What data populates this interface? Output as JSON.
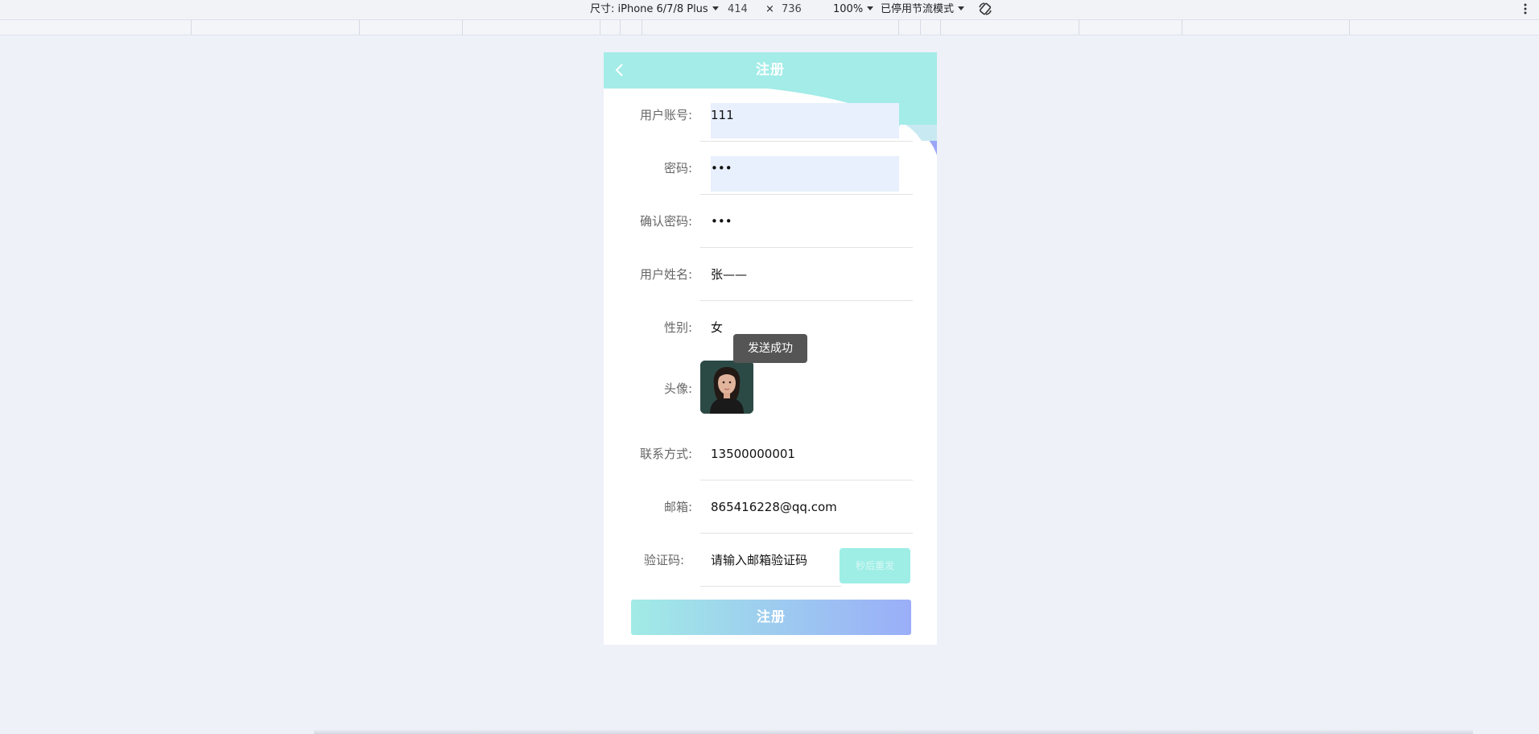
{
  "devtools": {
    "size_label": "尺寸: iPhone 6/7/8 Plus",
    "width": "414",
    "times": "×",
    "height": "736",
    "zoom": "100%",
    "throttle": "已停用节流模式"
  },
  "header": {
    "title": "注册",
    "back_icon": "chevron-left-icon"
  },
  "form": {
    "account": {
      "label": "用户账号:",
      "value": "111"
    },
    "password": {
      "label": "密码:",
      "value": "•••"
    },
    "confirm": {
      "label": "确认密码:",
      "value": "•••"
    },
    "name": {
      "label": "用户姓名:",
      "value": "张——"
    },
    "gender": {
      "label": "性别:",
      "value": "女"
    },
    "avatar": {
      "label": "头像:"
    },
    "phone": {
      "label": "联系方式:",
      "value": "13500000001"
    },
    "email": {
      "label": "邮箱:",
      "value": "865416228@qq.com"
    },
    "code": {
      "label": "验证码:",
      "placeholder": "请输入邮箱验证码",
      "button": "秒后重发"
    }
  },
  "toast": "发送成功",
  "submit": "注册",
  "colors": {
    "header": "#a3ece8",
    "accent_purple": "#9ba6f7",
    "submit_start": "#a1ebe6",
    "submit_end": "#9aaef8"
  }
}
